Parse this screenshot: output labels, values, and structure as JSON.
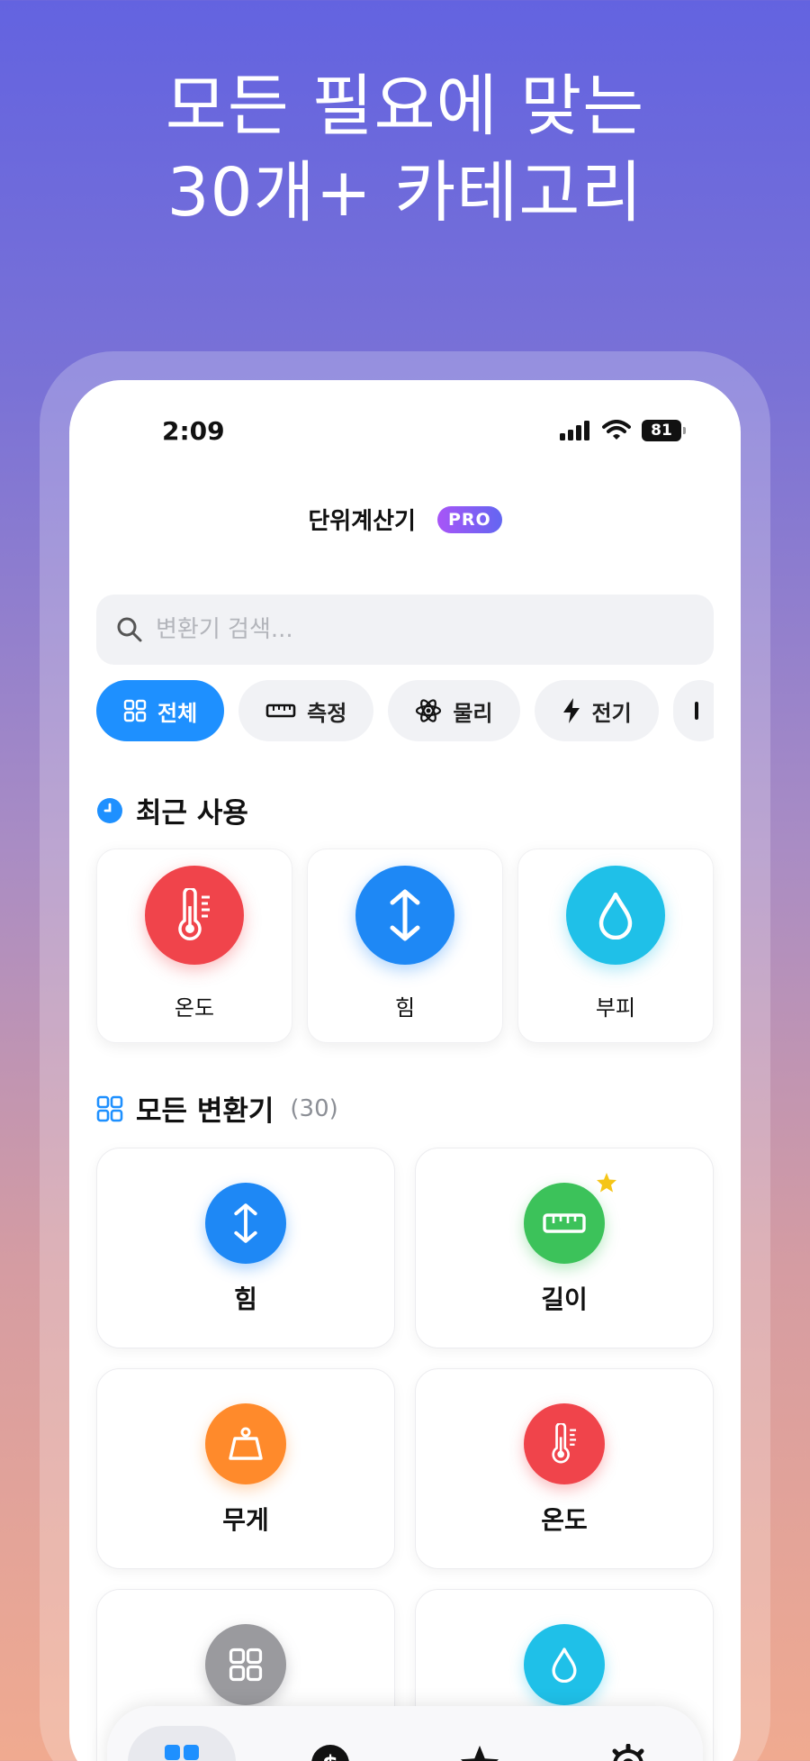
{
  "headline": {
    "line1": "모든 필요에 맞는",
    "line2": "30개+ 카테고리"
  },
  "status_bar": {
    "time": "2:09",
    "battery": "81"
  },
  "header": {
    "title": "단위계산기",
    "badge": "PRO"
  },
  "search": {
    "placeholder": "변환기 검색..."
  },
  "chips": [
    {
      "label": "전체",
      "icon": "grid-icon"
    },
    {
      "label": "측정",
      "icon": "ruler-icon"
    },
    {
      "label": "물리",
      "icon": "atom-icon"
    },
    {
      "label": "전기",
      "icon": "bolt-icon"
    }
  ],
  "recent": {
    "title": "최근 사용",
    "items": [
      {
        "label": "온도",
        "icon": "thermometer-icon",
        "color": "#f0444b"
      },
      {
        "label": "힘",
        "icon": "up-down-arrow-icon",
        "color": "#1e88f5"
      },
      {
        "label": "부피",
        "icon": "droplet-icon",
        "color": "#1fc0e8"
      }
    ]
  },
  "all": {
    "title": "모든 변환기",
    "count": "(30)",
    "items": [
      {
        "label": "힘",
        "icon": "up-down-arrow-icon",
        "color": "#1e88f5",
        "favorite": false
      },
      {
        "label": "길이",
        "icon": "ruler-icon",
        "color": "#3cc25a",
        "favorite": true
      },
      {
        "label": "무게",
        "icon": "weight-icon",
        "color": "#ff8a2b",
        "favorite": false
      },
      {
        "label": "온도",
        "icon": "thermometer-icon",
        "color": "#f0444b",
        "favorite": false
      },
      {
        "label": "",
        "icon": "grid-icon",
        "color": "#9a9a9e",
        "favorite": false
      },
      {
        "label": "",
        "icon": "droplet-icon",
        "color": "#1fc0e8",
        "favorite": false
      }
    ]
  },
  "tabbar": [
    {
      "icon": "grid-icon",
      "active": true
    },
    {
      "icon": "dollar-icon",
      "active": false
    },
    {
      "icon": "star-icon",
      "active": false
    },
    {
      "icon": "gear-icon",
      "active": false
    }
  ],
  "colors": {
    "accent": "#1e90ff",
    "favorite_star": "#f5c518"
  }
}
